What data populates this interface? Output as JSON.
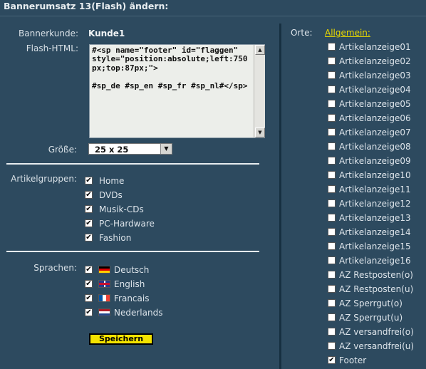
{
  "title": "Bannerumsatz 13(Flash) ändern:",
  "form": {
    "kunde_label": "Bannerkunde:",
    "kunde_value": "Kunde1",
    "flash_label": "Flash-HTML:",
    "flash_value": "#<sp name=\"footer\" id=\"flaggen\" style=\"position:absolute;left:750px;top:87px;\">\n\n#sp_de #sp_en #sp_fr #sp_nl#</sp>",
    "groesse_label": "Größe:",
    "groesse_value": "25 x 25",
    "artikelgruppen_label": "Artikelgruppen:",
    "artikelgruppen": [
      {
        "label": "Home",
        "checked": true
      },
      {
        "label": "DVDs",
        "checked": true
      },
      {
        "label": "Musik-CDs",
        "checked": true
      },
      {
        "label": "PC-Hardware",
        "checked": true
      },
      {
        "label": "Fashion",
        "checked": true
      }
    ],
    "sprachen_label": "Sprachen:",
    "sprachen": [
      {
        "label": "Deutsch",
        "flag": "flag-germany-icon",
        "checked": true
      },
      {
        "label": "English",
        "flag": "flag-uk-icon",
        "checked": true
      },
      {
        "label": "Francais",
        "flag": "flag-france-icon",
        "checked": true
      },
      {
        "label": "Nederlands",
        "flag": "flag-netherlands-icon",
        "checked": true
      }
    ],
    "save_label": "Speichern"
  },
  "orte": {
    "label": "Orte:",
    "allgemein_link": "Allgemein:",
    "items": [
      {
        "label": "Artikelanzeige01",
        "checked": false
      },
      {
        "label": "Artikelanzeige02",
        "checked": false
      },
      {
        "label": "Artikelanzeige03",
        "checked": false
      },
      {
        "label": "Artikelanzeige04",
        "checked": false
      },
      {
        "label": "Artikelanzeige05",
        "checked": false
      },
      {
        "label": "Artikelanzeige06",
        "checked": false
      },
      {
        "label": "Artikelanzeige07",
        "checked": false
      },
      {
        "label": "Artikelanzeige08",
        "checked": false
      },
      {
        "label": "Artikelanzeige09",
        "checked": false
      },
      {
        "label": "Artikelanzeige10",
        "checked": false
      },
      {
        "label": "Artikelanzeige11",
        "checked": false
      },
      {
        "label": "Artikelanzeige12",
        "checked": false
      },
      {
        "label": "Artikelanzeige13",
        "checked": false
      },
      {
        "label": "Artikelanzeige14",
        "checked": false
      },
      {
        "label": "Artikelanzeige15",
        "checked": false
      },
      {
        "label": "Artikelanzeige16",
        "checked": false
      },
      {
        "label": "AZ Restposten(o)",
        "checked": false
      },
      {
        "label": "AZ Restposten(u)",
        "checked": false
      },
      {
        "label": "AZ Sperrgut(o)",
        "checked": false
      },
      {
        "label": "AZ Sperrgut(u)",
        "checked": false
      },
      {
        "label": "AZ versandfrei(o)",
        "checked": false
      },
      {
        "label": "AZ versandfrei(u)",
        "checked": false
      },
      {
        "label": "Footer",
        "checked": true
      }
    ]
  },
  "colors": {
    "background": "#2d4a5f",
    "link": "#e9d800",
    "save_button": "#f3e300"
  }
}
